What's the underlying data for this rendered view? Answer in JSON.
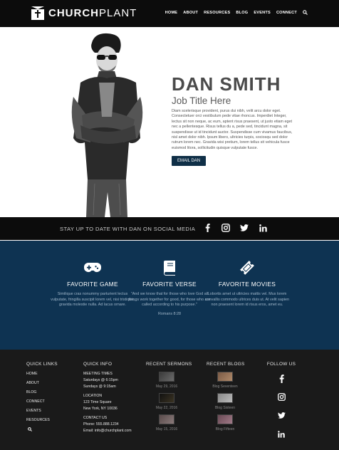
{
  "brand": {
    "name_bold": "CHURCH",
    "name_light": "PLANT"
  },
  "nav": [
    "HOME",
    "ABOUT",
    "RESOURCES",
    "BLOG",
    "EVENTS",
    "CONNECT"
  ],
  "hero": {
    "name": "DAN SMITH",
    "job_title": "Job Title Here",
    "bio": "Diam scelerisque provident, purus dui nibh, velit arcu dolor eget. Consectetuer orci vestibulum pede vitae rhoncus. Imperdiet Integer, lectus sit non neque, ac eum, aptent risus praesent, ut justo etiam eget nec a pellentesque. Risus tellus du a, pede sed, tincidunt magna, sit suspendisse ut id tincidunt auctor. Suspendisse cum vivamus faucibus, nisl amet dolor nibh. Ipsum libero, ultricies turpis, sociosqu sed dolor rutrum lorem nec. Gravida wisi pretium, lorem tellus sit vehicula fusce euismod litora, sollicitudin quisque vulputate fusce.",
    "button": "EMAIL DAN"
  },
  "social": {
    "text": "STAY UP TO DATE WITH DAN ON SOCIAL MEDIA"
  },
  "favorites": [
    {
      "icon": "gamepad-icon",
      "title": "FAVORITE GAME",
      "body": "Similique cras nonummy parturient lectus vulputate, fringilla suscipit lorem vel, nisi tristique, gravida molestie nulla. Ad lacus ornare.",
      "ref": ""
    },
    {
      "icon": "book-icon",
      "title": "FAVORITE VERSE",
      "body": "\"And we know that for those who love God all things work together for good, for those who are called according to his purpose.\"",
      "ref": "Romans 8:28"
    },
    {
      "icon": "ticket-icon",
      "title": "FAVORITE MOVIES",
      "body": "Lobortis amet ut ultricies mattis vel. Mus lorem convallis commodo ultrices duis ut. At velit sapien non praesent lorem id risus eros, amet eu.",
      "ref": ""
    }
  ],
  "footer": {
    "quick_links": {
      "heading": "QUICK LINKS",
      "links": [
        "HOME",
        "ABOUT",
        "BLOG",
        "CONNECT",
        "EVENTS",
        "RESOURCES"
      ]
    },
    "quick_info": {
      "heading": "QUICK INFO",
      "meeting_heading": "MEETING TIMES",
      "meeting": [
        "Saturdays @ 6:15pm",
        "Sundays @ 9:15am"
      ],
      "location_heading": "LOCATION",
      "location": [
        "123 Time Square",
        "New York, NY 10036"
      ],
      "contact_heading": "CONTACT US",
      "contact": [
        "Phone: 555.888.1234",
        "Email: info@churchplant.com"
      ]
    },
    "sermons": {
      "heading": "RECENT SERMONS",
      "items": [
        "May 29, 2016",
        "May 22, 2016",
        "May 15, 2016"
      ]
    },
    "blogs": {
      "heading": "RECENT BLOGS",
      "items": [
        "Blog Seventeen",
        "Blog Sixteen",
        "Blog Fifteen"
      ]
    },
    "follow": {
      "heading": "FOLLOW US"
    }
  },
  "colors": {
    "header_bg": "#0c0c0c",
    "accent_navy": "#0e3352",
    "button": "#0f2f47",
    "footer_bg": "#1a1a1a"
  }
}
